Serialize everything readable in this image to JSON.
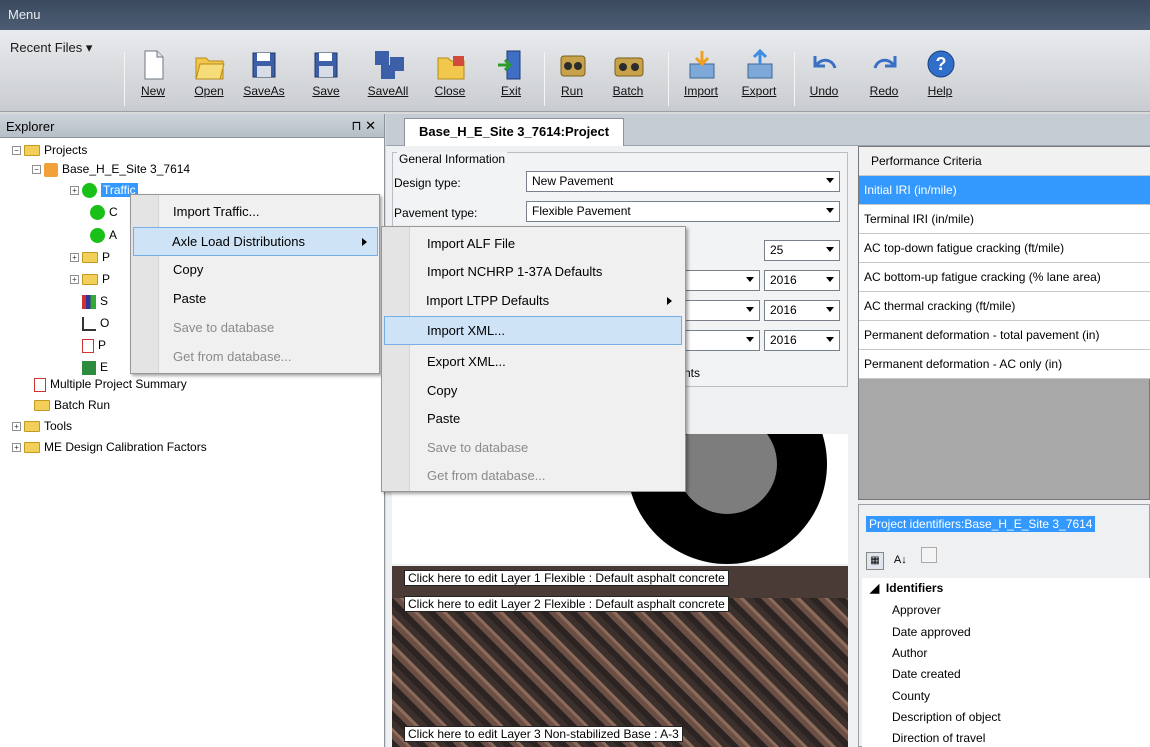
{
  "menubar": {
    "title": "Menu"
  },
  "ribbon": {
    "recent_files": "Recent Files ▾",
    "buttons": [
      {
        "label": "New",
        "icon": "new-file-icon"
      },
      {
        "label": "Open",
        "icon": "open-folder-icon"
      },
      {
        "label": "SaveAs",
        "icon": "save-as-icon"
      },
      {
        "label": "Save",
        "icon": "save-icon"
      },
      {
        "label": "SaveAll",
        "icon": "save-all-icon"
      },
      {
        "label": "Close",
        "icon": "close-folder-icon"
      },
      {
        "label": "Exit",
        "icon": "exit-door-icon"
      },
      {
        "label": "Run",
        "icon": "run-icon"
      },
      {
        "label": "Batch",
        "icon": "batch-icon"
      },
      {
        "label": "Import",
        "icon": "import-icon"
      },
      {
        "label": "Export",
        "icon": "export-icon"
      },
      {
        "label": "Undo",
        "icon": "undo-icon"
      },
      {
        "label": "Redo",
        "icon": "redo-icon"
      },
      {
        "label": "Help",
        "icon": "help-icon"
      }
    ]
  },
  "explorer": {
    "title": "Explorer",
    "pin": "⊓ ✕",
    "projects": "Projects",
    "project_name": "Base_H_E_Site 3_7614",
    "traffic": "Traffic",
    "child_c": "C",
    "child_a": "A",
    "child_p1": "P",
    "child_p2": "P",
    "child_s": "S",
    "child_o": "O",
    "child_p3": "P",
    "child_e": "E",
    "multiple_summary": "Multiple Project Summary",
    "batch_run": "Batch Run",
    "tools": "Tools",
    "calibration": "ME Design Calibration Factors"
  },
  "tab": {
    "title": "Base_H_E_Site 3_7614:Project"
  },
  "general": {
    "title": "General Information",
    "design_type_label": "Design type:",
    "design_type_value": "New Pavement",
    "pavement_type_label": "Pavement type:",
    "pavement_type_value": "Flexible Pavement",
    "design_life_value": "25",
    "year1": "2016",
    "year2": "2016",
    "year3": "2016",
    "trailing_text": "nts"
  },
  "performance": {
    "header": "Performance Criteria",
    "rows": [
      "Initial IRI  (in/mile)",
      "Terminal IRI (in/mile)",
      "AC top-down fatigue cracking (ft/mile)",
      "AC bottom-up fatigue cracking (% lane area)",
      "AC thermal cracking (ft/mile)",
      "Permanent deformation - total pavement (in)",
      "Permanent deformation - AC only (in)"
    ]
  },
  "identifiers": {
    "title": "Project identifiers:Base_H_E_Site 3_7614",
    "section": "Identifiers",
    "rows": [
      "Approver",
      "Date approved",
      "Author",
      "Date created",
      "County",
      "Description of object",
      "Direction of travel"
    ]
  },
  "layers": [
    "Click here to edit Layer 1 Flexible : Default asphalt concrete",
    "Click here to edit Layer 2 Flexible : Default asphalt concrete",
    "Click here to edit Layer 3 Non-stabilized Base : A-3"
  ],
  "context_menu_1": {
    "items": [
      {
        "label": "Import Traffic...",
        "enabled": true
      },
      {
        "label": "Axle Load Distributions",
        "enabled": true
      },
      {
        "label": "Copy",
        "enabled": true
      },
      {
        "label": "Paste",
        "enabled": true
      },
      {
        "label": "Save to database",
        "enabled": false
      },
      {
        "label": "Get from database...",
        "enabled": false
      }
    ]
  },
  "context_menu_2": {
    "items": [
      {
        "label": "Import ALF File",
        "enabled": true
      },
      {
        "label": "Import NCHRP 1-37A Defaults",
        "enabled": true
      },
      {
        "label": "Import LTPP Defaults",
        "enabled": true
      },
      {
        "label": "Import XML...",
        "enabled": true
      },
      {
        "label": "Export XML...",
        "enabled": true
      },
      {
        "label": "Copy",
        "enabled": true
      },
      {
        "label": "Paste",
        "enabled": true
      },
      {
        "label": "Save to database",
        "enabled": false
      },
      {
        "label": "Get from database...",
        "enabled": false
      }
    ]
  }
}
